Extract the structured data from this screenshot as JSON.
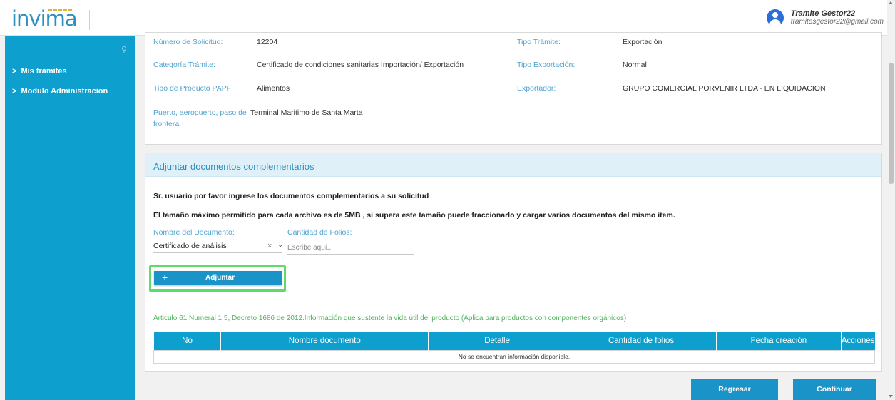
{
  "brand": {
    "logo_text": "invima"
  },
  "user": {
    "name": "Tramite Gestor22",
    "email": "tramitesgestor22@gmail.com"
  },
  "sidebar": {
    "search_icon": "search-icon",
    "items": [
      {
        "label": "Mis trámites"
      },
      {
        "label": "Modulo Administracion"
      }
    ]
  },
  "request_info": {
    "numero_solicitud": {
      "label": "Número de Solicitud:",
      "value": "12204"
    },
    "tipo_tramite": {
      "label": "Tipo Trámite:",
      "value": "Exportación"
    },
    "categoria": {
      "label": "Categoría Trámite:",
      "value": "Certificado de condiciones sanitarias Importación/ Exportación"
    },
    "tipo_exportacion": {
      "label": "Tipo Exportación:",
      "value": "Normal"
    },
    "tipo_producto": {
      "label": "Tipo de Producto PAPF:",
      "value": "Alimentos"
    },
    "exportador": {
      "label": "Exportador:",
      "value": "GRUPO COMERCIAL PORVENIR LTDA - EN LIQUIDACION"
    },
    "puerto": {
      "label_line1": "Puerto, aeropuerto, paso de",
      "label_line2": "frontera:",
      "value": "Terminal Maritimo de Santa Marta"
    }
  },
  "docs": {
    "title": "Adjuntar documentos complementarios",
    "instruction": "Sr. usuario por favor ingrese los documentos complementarios a su solicitud",
    "size_note": "El tamaño máximo permitido para cada archivo es de 5MB , si supera este tamaño puede fraccionarlo y cargar varios documentos del mismo item.",
    "document_label": "Nombre del Documento:",
    "document_value": "Certificado de análisis",
    "folios_label": "Cantidad de Folios:",
    "folios_placeholder": "Escribe aquí...",
    "attach_plus": "+",
    "attach_label": "Adjuntar",
    "article_note": "Articulo 61 Numeral 1,5, Decreto 1686 de 2012.Información que sustente la vida útil del producto (Aplica para productos con componentes orgánicos)",
    "table": {
      "headers": [
        "No",
        "Nombre documento",
        "Detalle",
        "Cantidad de folios",
        "Fecha creación",
        "Acciones"
      ],
      "empty_message": "No se encuentran información disponible."
    }
  },
  "actions": {
    "back": "Regresar",
    "next": "Continuar"
  },
  "colors": {
    "primary": "#0da0ce",
    "button": "#1a94c8",
    "highlight": "#5ddc6a",
    "note": "#4db35a",
    "label": "#4fa3cf"
  }
}
